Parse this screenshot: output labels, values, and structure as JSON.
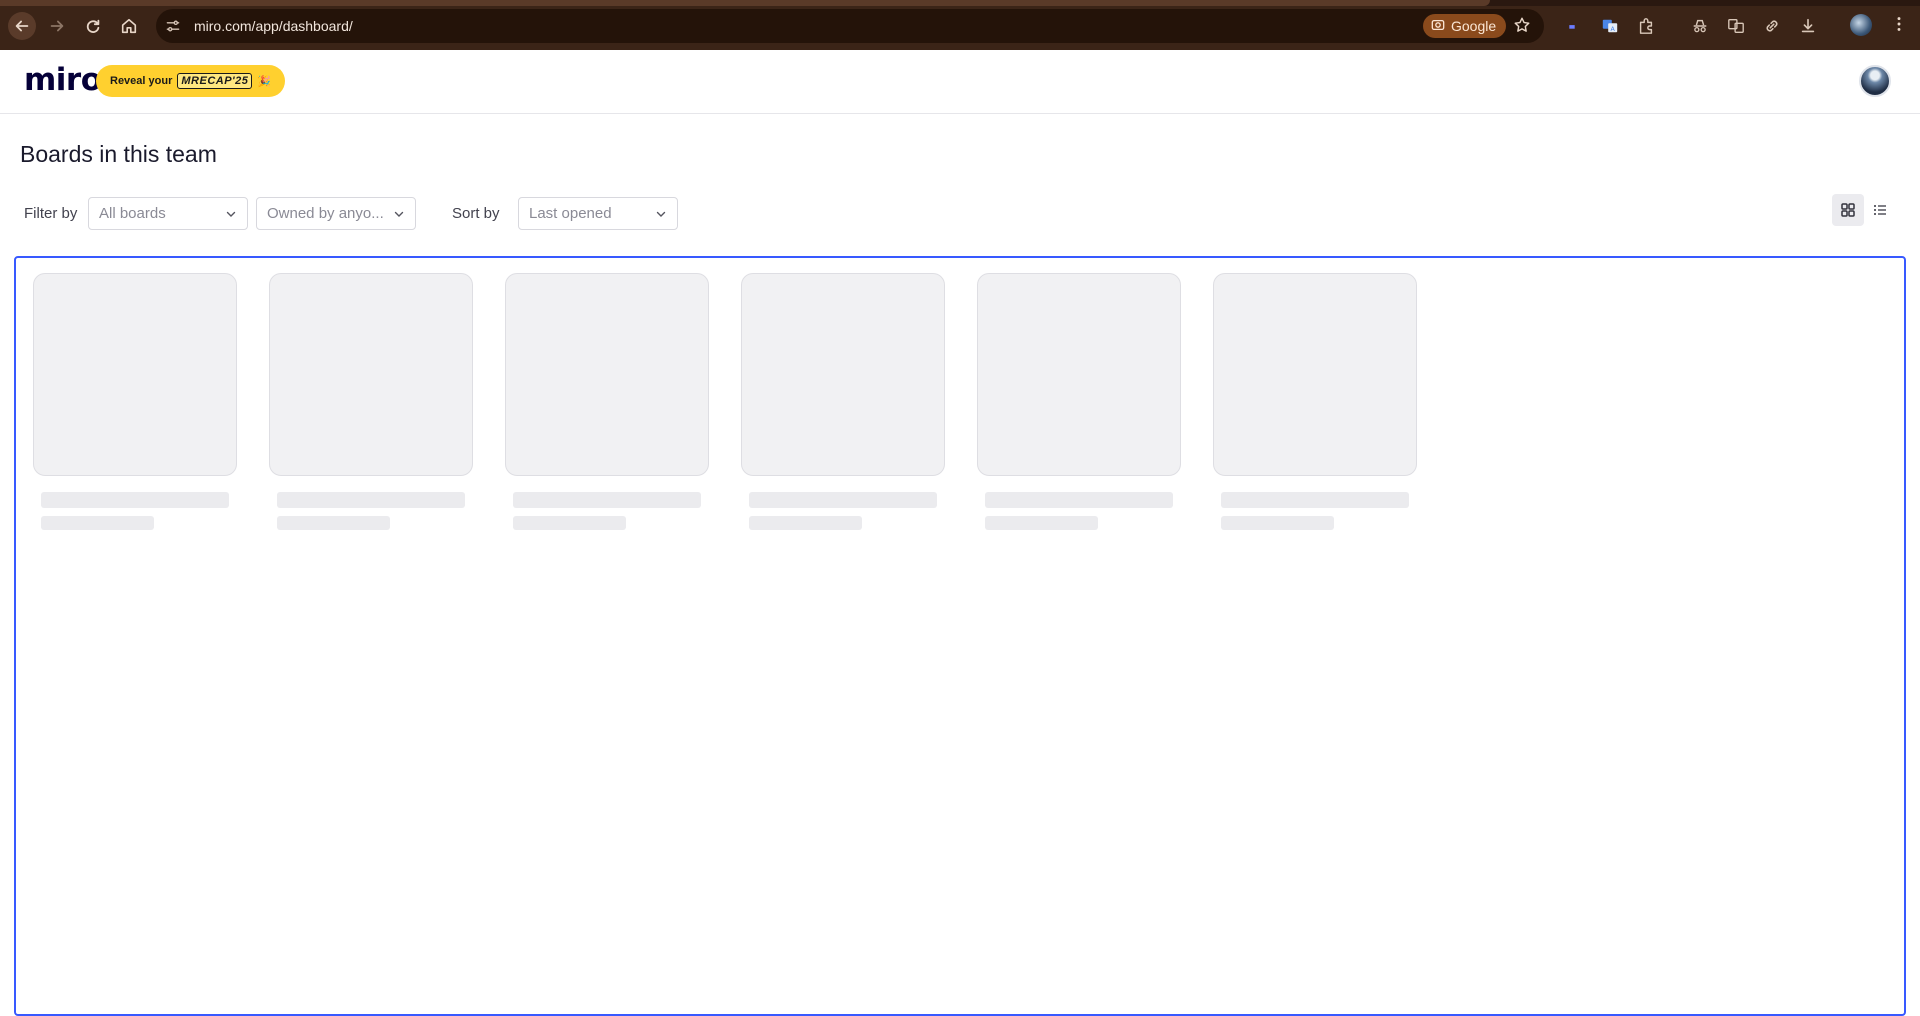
{
  "browser": {
    "url": "miro.com/app/dashboard/",
    "search_chip": "Google",
    "icons": [
      "back-icon",
      "forward-icon",
      "reload-icon",
      "home-icon",
      "site-settings-icon",
      "star-icon",
      "extension-icon",
      "translate-icon",
      "puzzle-icon",
      "incognito-icon",
      "link-icon",
      "download-icon",
      "more-icon"
    ]
  },
  "header": {
    "logo": "miro",
    "recap_prefix": "Reveal your",
    "recap_badge": "MRECAP'25",
    "recap_emoji": "🎉"
  },
  "main": {
    "title": "Boards in this team",
    "filter_label": "Filter by",
    "filter_boards": "All boards",
    "filter_owner": "Owned by anyo...",
    "sort_label": "Sort by",
    "sort_value": "Last opened"
  },
  "colors": {
    "accent": "#3859ff",
    "recap_bg": "#ffd02f",
    "chrome_bg": "#3b2417"
  },
  "placeholder_cards": 6
}
